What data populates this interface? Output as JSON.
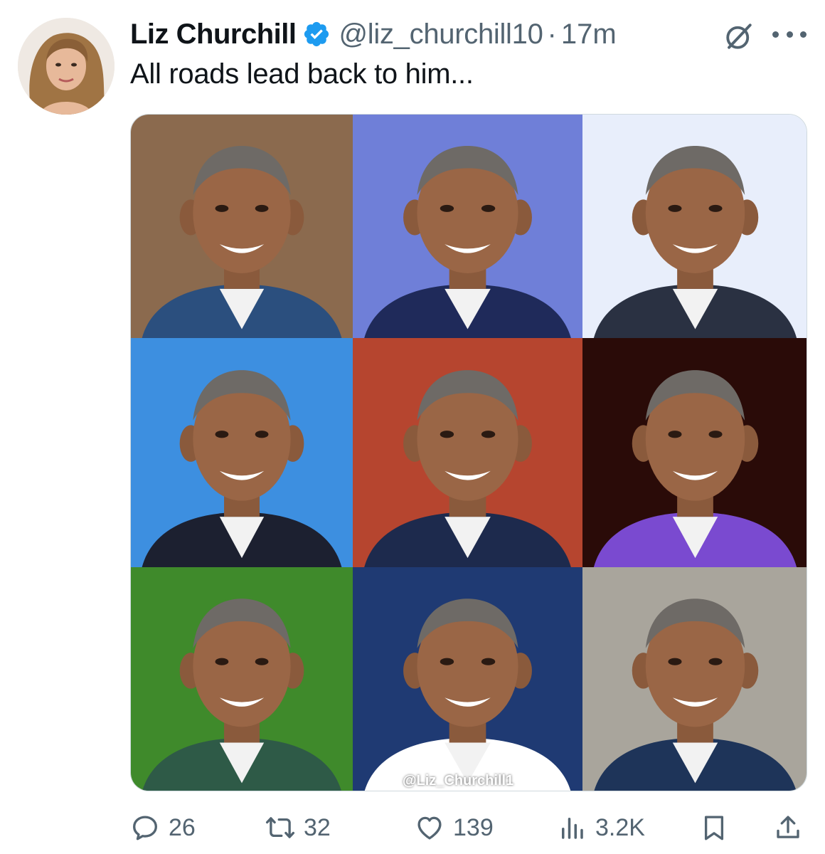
{
  "author": {
    "name": "Liz Churchill",
    "handle": "@liz_churchill10",
    "separator": "·",
    "time": "17m"
  },
  "tweet": {
    "text": "All roads lead back to him..."
  },
  "media": {
    "watermark": "@Liz_Churchill1",
    "panels": [
      {
        "bg": "#8b6a4e",
        "suit": "#2b4f7e"
      },
      {
        "bg": "#6f7fd8",
        "suit": "#1f2a5a"
      },
      {
        "bg": "#e8eefb",
        "suit": "#2a3142"
      },
      {
        "bg": "#3d8fe0",
        "suit": "#1c2030"
      },
      {
        "bg": "#b6452f",
        "suit": "#1d2a4d"
      },
      {
        "bg": "#2a0b08",
        "suit": "#7a4ad0"
      },
      {
        "bg": "#3f8a2b",
        "suit": "#2e5a47"
      },
      {
        "bg": "#1f3a73",
        "suit": "#ffffff"
      },
      {
        "bg": "#a9a59c",
        "suit": "#1e3459"
      }
    ]
  },
  "actions": {
    "replies": "26",
    "reposts": "32",
    "likes": "139",
    "views": "3.2K"
  },
  "icons": {
    "verified": "verified-badge-icon",
    "grok": "grok-icon",
    "more": "more-icon",
    "reply": "reply-icon",
    "repost": "repost-icon",
    "like": "heart-icon",
    "views": "views-icon",
    "bookmark": "bookmark-icon",
    "share": "share-icon"
  },
  "colors": {
    "text": "#0f1419",
    "secondary": "#536471",
    "verified": "#1d9bf0"
  }
}
